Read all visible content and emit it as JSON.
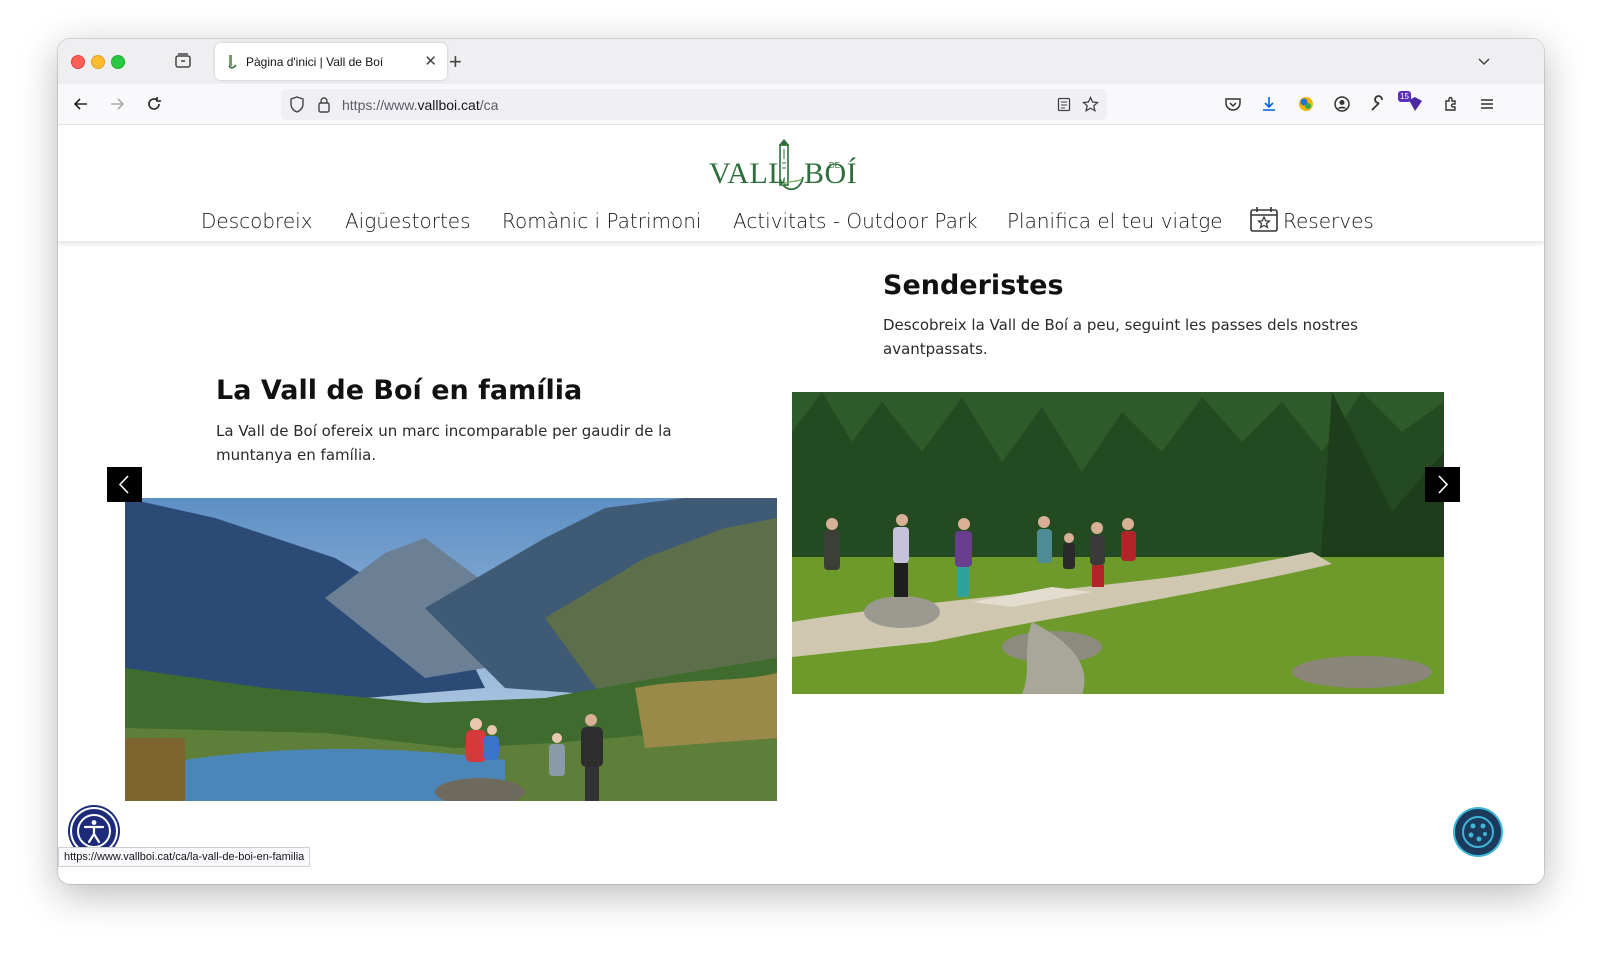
{
  "browser": {
    "tab_title": "Pàgina d'inici | Vall de Boí",
    "url_prefix": "https://www.",
    "url_host": "vallboi.cat",
    "url_path": "/ca",
    "extension_badge": "15",
    "status_url": "https://www.vallboi.cat/ca/la-vall-de-boi-en-familia"
  },
  "site": {
    "logo": {
      "left": "VALL",
      "de": "DE",
      "right": "BOÍ"
    },
    "nav": [
      {
        "label": "Descobreix"
      },
      {
        "label": "Aigüestortes"
      },
      {
        "label": "Romànic i Patrimoni"
      },
      {
        "label": "Activitats - Outdoor Park"
      },
      {
        "label": "Planifica el teu viatge"
      },
      {
        "label": "Reserves"
      }
    ]
  },
  "cards": [
    {
      "title": "La Vall de Boí en família",
      "desc": "La Vall de Boí ofereix un marc incomparable per gaudir de la muntanya en família."
    },
    {
      "title": "Senderistes",
      "desc": "Descobreix la Vall de Boí a peu, seguint les passes dels nostres avantpassats."
    }
  ],
  "colors": {
    "brand": "#2e6e3a",
    "accent": "#3fb6d8"
  }
}
